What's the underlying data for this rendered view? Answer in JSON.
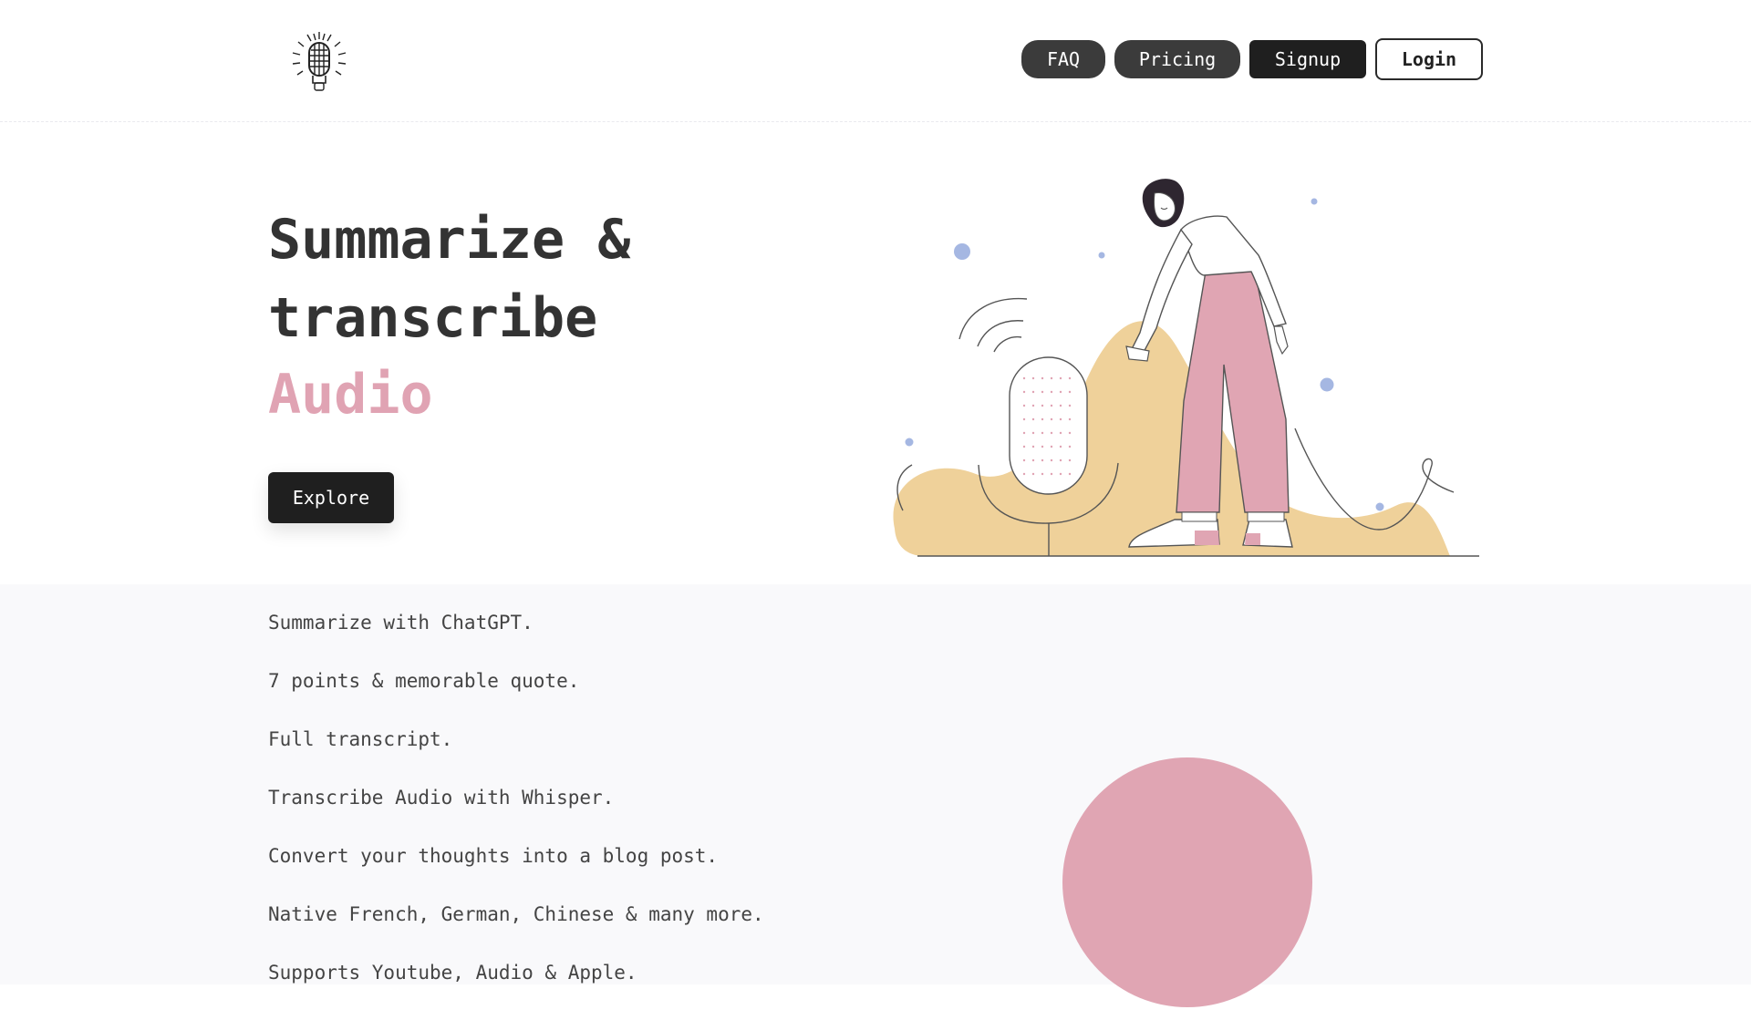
{
  "header": {
    "logo_icon": "microphone-icon",
    "nav": {
      "faq_label": "FAQ",
      "pricing_label": "Pricing",
      "signup_label": "Signup",
      "login_label": "Login"
    }
  },
  "hero": {
    "title_line1": "Summarize &",
    "title_line2": "transcribe",
    "accent": "Audio",
    "explore_label": "Explore",
    "illustration_icon": "woman-with-microphone-illustration"
  },
  "features": {
    "items": [
      "Summarize with ChatGPT.",
      "7 points & memorable quote.",
      "Full transcript.",
      "Transcribe Audio with Whisper.",
      "Convert your thoughts into a blog post.",
      "Native French, German, Chinese & many more.",
      "Supports Youtube, Audio & Apple."
    ]
  },
  "colors": {
    "accent_pink": "#e0a3b3",
    "dark_button": "#1f1f1f",
    "sand": "#efd19a",
    "dot_blue": "#a5b7e2"
  }
}
